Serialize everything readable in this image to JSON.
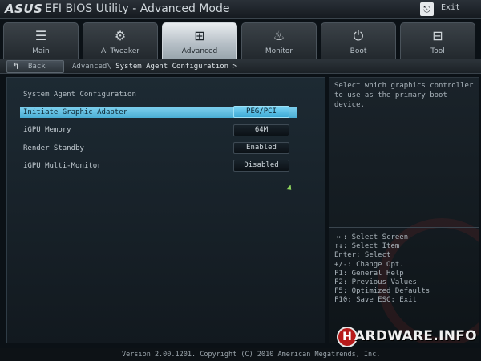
{
  "header": {
    "logo": "ASUS",
    "title": "EFI BIOS Utility - Advanced Mode",
    "exit_label": "Exit",
    "exit_icon": "exit-door-icon"
  },
  "tabs": [
    {
      "label": "Main",
      "icon": "list-icon",
      "glyph": "☰",
      "active": false
    },
    {
      "label": "Ai Tweaker",
      "icon": "tweaker-icon",
      "glyph": "⚙",
      "active": false
    },
    {
      "label": "Advanced",
      "icon": "advanced-icon",
      "glyph": "⊞",
      "active": true
    },
    {
      "label": "Monitor",
      "icon": "monitor-icon",
      "glyph": "♨",
      "active": false
    },
    {
      "label": "Boot",
      "icon": "power-icon",
      "glyph": "⏻",
      "active": false
    },
    {
      "label": "Tool",
      "icon": "toolbox-icon",
      "glyph": "⊟",
      "active": false
    }
  ],
  "navigation": {
    "back_label": "Back",
    "breadcrumb_parent": "Advanced\\",
    "breadcrumb_current": "System Agent Configuration >"
  },
  "main": {
    "section_title": "System Agent Configuration",
    "settings": [
      {
        "label": "Initiate Graphic Adapter",
        "value": "PEG/PCI",
        "selected": true
      },
      {
        "label": "iGPU Memory",
        "value": "64M",
        "selected": false
      },
      {
        "label": "Render Standby",
        "value": "Enabled",
        "selected": false
      },
      {
        "label": "iGPU Multi-Monitor",
        "value": "Disabled",
        "selected": false
      }
    ]
  },
  "help": {
    "description": "Select which graphics controller to use as the primary boot device.",
    "keys": [
      "→←: Select Screen",
      "↑↓: Select Item",
      "Enter: Select",
      "+/-: Change Opt.",
      "F1: General Help",
      "F2: Previous Values",
      "F5: Optimized Defaults",
      "F10: Save  ESC: Exit"
    ]
  },
  "brand": {
    "letter": "H",
    "text": "ARDWARE.INFO"
  },
  "footer": {
    "copyright": "Version 2.00.1201. Copyright (C) 2010 American Megatrends, Inc."
  },
  "colors": {
    "accent": "#4aaed4",
    "background": "#0b1116"
  }
}
